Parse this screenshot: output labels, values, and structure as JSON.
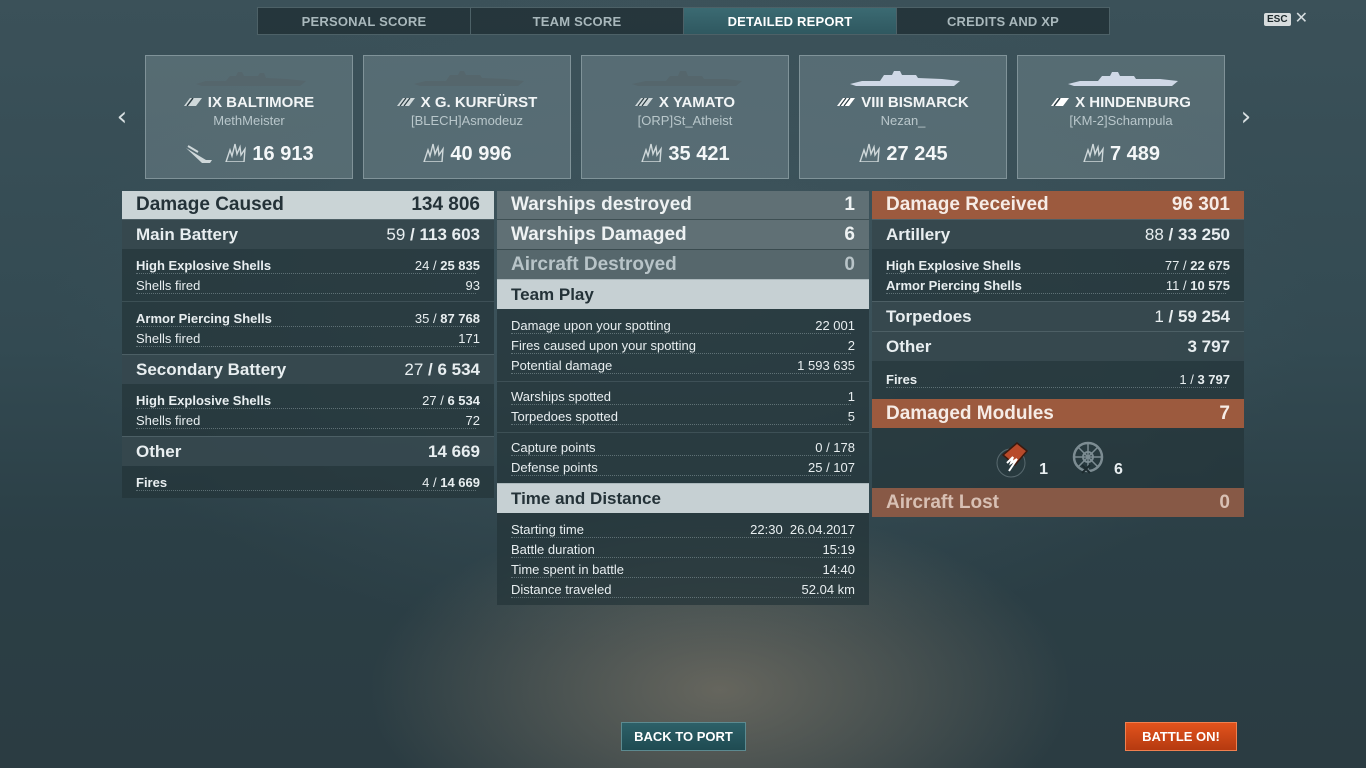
{
  "tabs": [
    {
      "label": "PERSONAL SCORE"
    },
    {
      "label": "TEAM SCORE"
    },
    {
      "label": "DETAILED REPORT"
    },
    {
      "label": "CREDITS AND XP"
    }
  ],
  "esc": {
    "key": "ESC",
    "close": "✕"
  },
  "nav": {
    "prev": "‹",
    "next": "›"
  },
  "ships": [
    {
      "tier_name": "IX BALTIMORE",
      "player": "MethMeister",
      "damage": "16 913",
      "sunk": true,
      "enemy_color": false
    },
    {
      "tier_name": "X G. KURFÜRST",
      "player": "[BLECH]Asmodeuz",
      "damage": "40 996",
      "sunk": false,
      "enemy_color": false
    },
    {
      "tier_name": "X YAMATO",
      "player": "[ORP]St_Atheist",
      "damage": "35 421",
      "sunk": false,
      "enemy_color": false
    },
    {
      "tier_name": "VIII BISMARCK",
      "player": "Nezan_",
      "damage": "27 245",
      "sunk": false,
      "enemy_color": true
    },
    {
      "tier_name": "X HINDENBURG",
      "player": "[KM-2]Schampula",
      "damage": "7 489",
      "sunk": false,
      "enemy_color": true
    }
  ],
  "left": {
    "damage_caused": {
      "label": "Damage Caused",
      "value": "134 806"
    },
    "main_battery": {
      "label": "Main Battery",
      "hits": "59",
      "damage": "113 603"
    },
    "mb_he": {
      "label": "High Explosive Shells",
      "hits": "24",
      "damage": "25 835"
    },
    "mb_he_fired": {
      "label": "Shells fired",
      "value": "93"
    },
    "mb_ap": {
      "label": "Armor Piercing Shells",
      "hits": "35",
      "damage": "87 768"
    },
    "mb_ap_fired": {
      "label": "Shells fired",
      "value": "171"
    },
    "secondary": {
      "label": "Secondary Battery",
      "hits": "27",
      "damage": "6 534"
    },
    "sec_he": {
      "label": "High Explosive Shells",
      "hits": "27",
      "damage": "6 534"
    },
    "sec_he_fired": {
      "label": "Shells fired",
      "value": "72"
    },
    "other": {
      "label": "Other",
      "value": "14 669"
    },
    "fires": {
      "label": "Fires",
      "hits": "4",
      "damage": "14 669"
    }
  },
  "middle": {
    "destroyed": {
      "label": "Warships destroyed",
      "value": "1"
    },
    "damaged": {
      "label": "Warships Damaged",
      "value": "6"
    },
    "aircraft": {
      "label": "Aircraft Destroyed",
      "value": "0"
    },
    "team_play": {
      "label": "Team Play"
    },
    "spotting_damage": {
      "label": "Damage upon your spotting",
      "value": "22 001"
    },
    "spotting_fires": {
      "label": "Fires caused upon your spotting",
      "value": "2"
    },
    "potential": {
      "label": "Potential damage",
      "value": "1 593 635"
    },
    "ships_spotted": {
      "label": "Warships spotted",
      "value": "1"
    },
    "torps_spotted": {
      "label": "Torpedoes spotted",
      "value": "5"
    },
    "capture": {
      "label": "Capture points",
      "value": "0 / 178"
    },
    "defense": {
      "label": "Defense points",
      "value": "25 / 107"
    },
    "time_distance": {
      "label": "Time and Distance"
    },
    "start": {
      "label": "Starting time",
      "time": "22:30",
      "date": "26.04.2017"
    },
    "duration": {
      "label": "Battle duration",
      "value": "15:19"
    },
    "time_spent": {
      "label": "Time spent in battle",
      "value": "14:40"
    },
    "distance": {
      "label": "Distance traveled",
      "value": "52.04 km"
    }
  },
  "right": {
    "received": {
      "label": "Damage Received",
      "value": "96 301"
    },
    "artillery": {
      "label": "Artillery",
      "hits": "88",
      "damage": "33 250"
    },
    "art_he": {
      "label": "High Explosive Shells",
      "hits": "77",
      "damage": "22 675"
    },
    "art_ap": {
      "label": "Armor Piercing Shells",
      "hits": "11",
      "damage": "10 575"
    },
    "torpedoes": {
      "label": "Torpedoes",
      "hits": "1",
      "damage": "59 254"
    },
    "other": {
      "label": "Other",
      "value": "3 797"
    },
    "fires": {
      "label": "Fires",
      "hits": "1",
      "damage": "3 797"
    },
    "modules": {
      "label": "Damaged Modules",
      "value": "7",
      "engine_count": "1",
      "steering_count": "6"
    },
    "aircraft_lost": {
      "label": "Aircraft Lost",
      "value": "0"
    }
  },
  "buttons": {
    "back": "BACK TO PORT",
    "battle": "BATTLE ON!"
  },
  "colors": {
    "accent_orange": "#d94a17",
    "received_header": "#9c5a3e",
    "tab_active": "#2f5860"
  }
}
